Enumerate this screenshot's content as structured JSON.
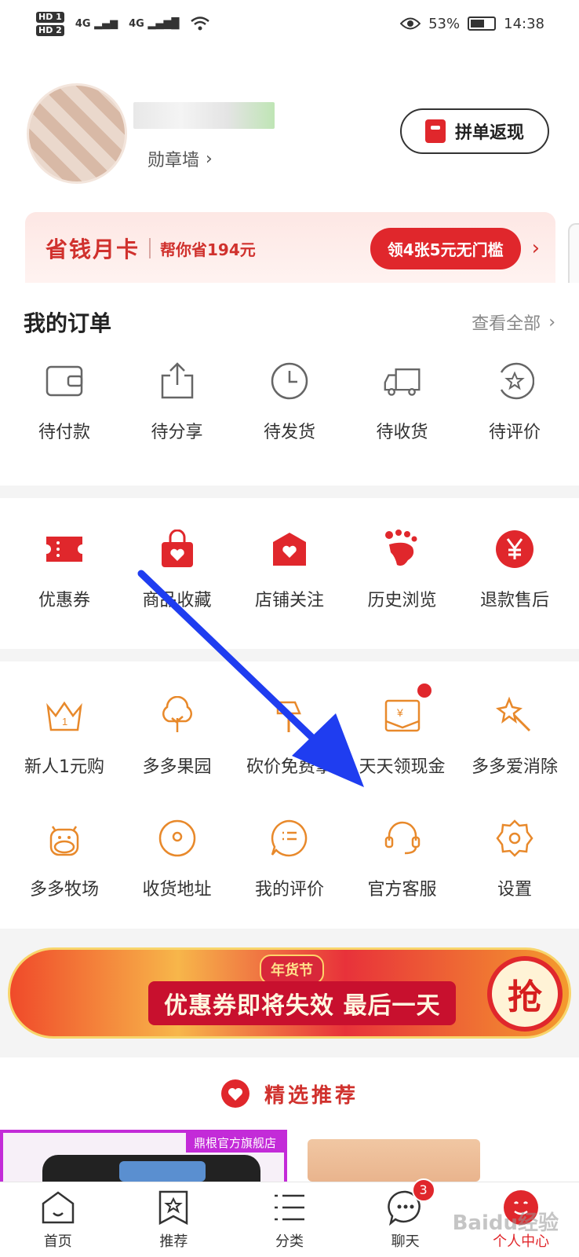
{
  "status_bar": {
    "network1": "4G",
    "network2": "4G",
    "battery_pct": "53%",
    "time": "14:38",
    "hd1": "HD 1",
    "hd2": "HD 2"
  },
  "profile": {
    "badge_wall": "勋章墙",
    "group_cashback": "拼单返现"
  },
  "savings_card": {
    "title": "省钱月卡",
    "subtitle": "帮你省194元",
    "button": "领4张5元无门槛"
  },
  "orders": {
    "title": "我的订单",
    "view_all": "查看全部",
    "items": [
      {
        "label": "待付款",
        "icon": "wallet-icon"
      },
      {
        "label": "待分享",
        "icon": "share-icon"
      },
      {
        "label": "待发货",
        "icon": "clock-icon"
      },
      {
        "label": "待收货",
        "icon": "truck-icon"
      },
      {
        "label": "待评价",
        "icon": "star-review-icon"
      }
    ]
  },
  "services": [
    {
      "label": "优惠券",
      "icon": "coupon-icon"
    },
    {
      "label": "商品收藏",
      "icon": "favorite-bag-icon"
    },
    {
      "label": "店铺关注",
      "icon": "store-icon"
    },
    {
      "label": "历史浏览",
      "icon": "footprint-icon"
    },
    {
      "label": "退款售后",
      "icon": "refund-yen-icon"
    }
  ],
  "tools_row1": [
    {
      "label": "新人1元购",
      "icon": "crown-icon"
    },
    {
      "label": "多多果园",
      "icon": "tree-icon"
    },
    {
      "label": "砍价免费拿",
      "icon": "axe-icon"
    },
    {
      "label": "天天领现金",
      "icon": "cash-envelope-icon"
    },
    {
      "label": "多多爱消除",
      "icon": "magic-wand-icon"
    }
  ],
  "tools_row2": [
    {
      "label": "多多牧场",
      "icon": "cow-icon"
    },
    {
      "label": "收货地址",
      "icon": "location-icon"
    },
    {
      "label": "我的评价",
      "icon": "comment-icon"
    },
    {
      "label": "官方客服",
      "icon": "headset-icon"
    },
    {
      "label": "设置",
      "icon": "gear-icon"
    }
  ],
  "banner": {
    "text": "优惠券即将失效 最后一天",
    "tag": "年货节",
    "grab": "抢"
  },
  "recommend": {
    "title": "精选推荐"
  },
  "products": {
    "store_tag": "鼎根官方旗舰店"
  },
  "tabbar": [
    {
      "label": "首页",
      "icon": "home-icon"
    },
    {
      "label": "推荐",
      "icon": "recommend-icon"
    },
    {
      "label": "分类",
      "icon": "category-icon"
    },
    {
      "label": "聊天",
      "icon": "chat-icon",
      "badge": "3"
    },
    {
      "label": "个人中心",
      "icon": "profile-icon"
    }
  ],
  "watermark": "Baidu经验",
  "colors": {
    "brand_red": "#e0272c",
    "accent_orange": "#e8892b",
    "annotation_blue": "#1f3df0"
  }
}
